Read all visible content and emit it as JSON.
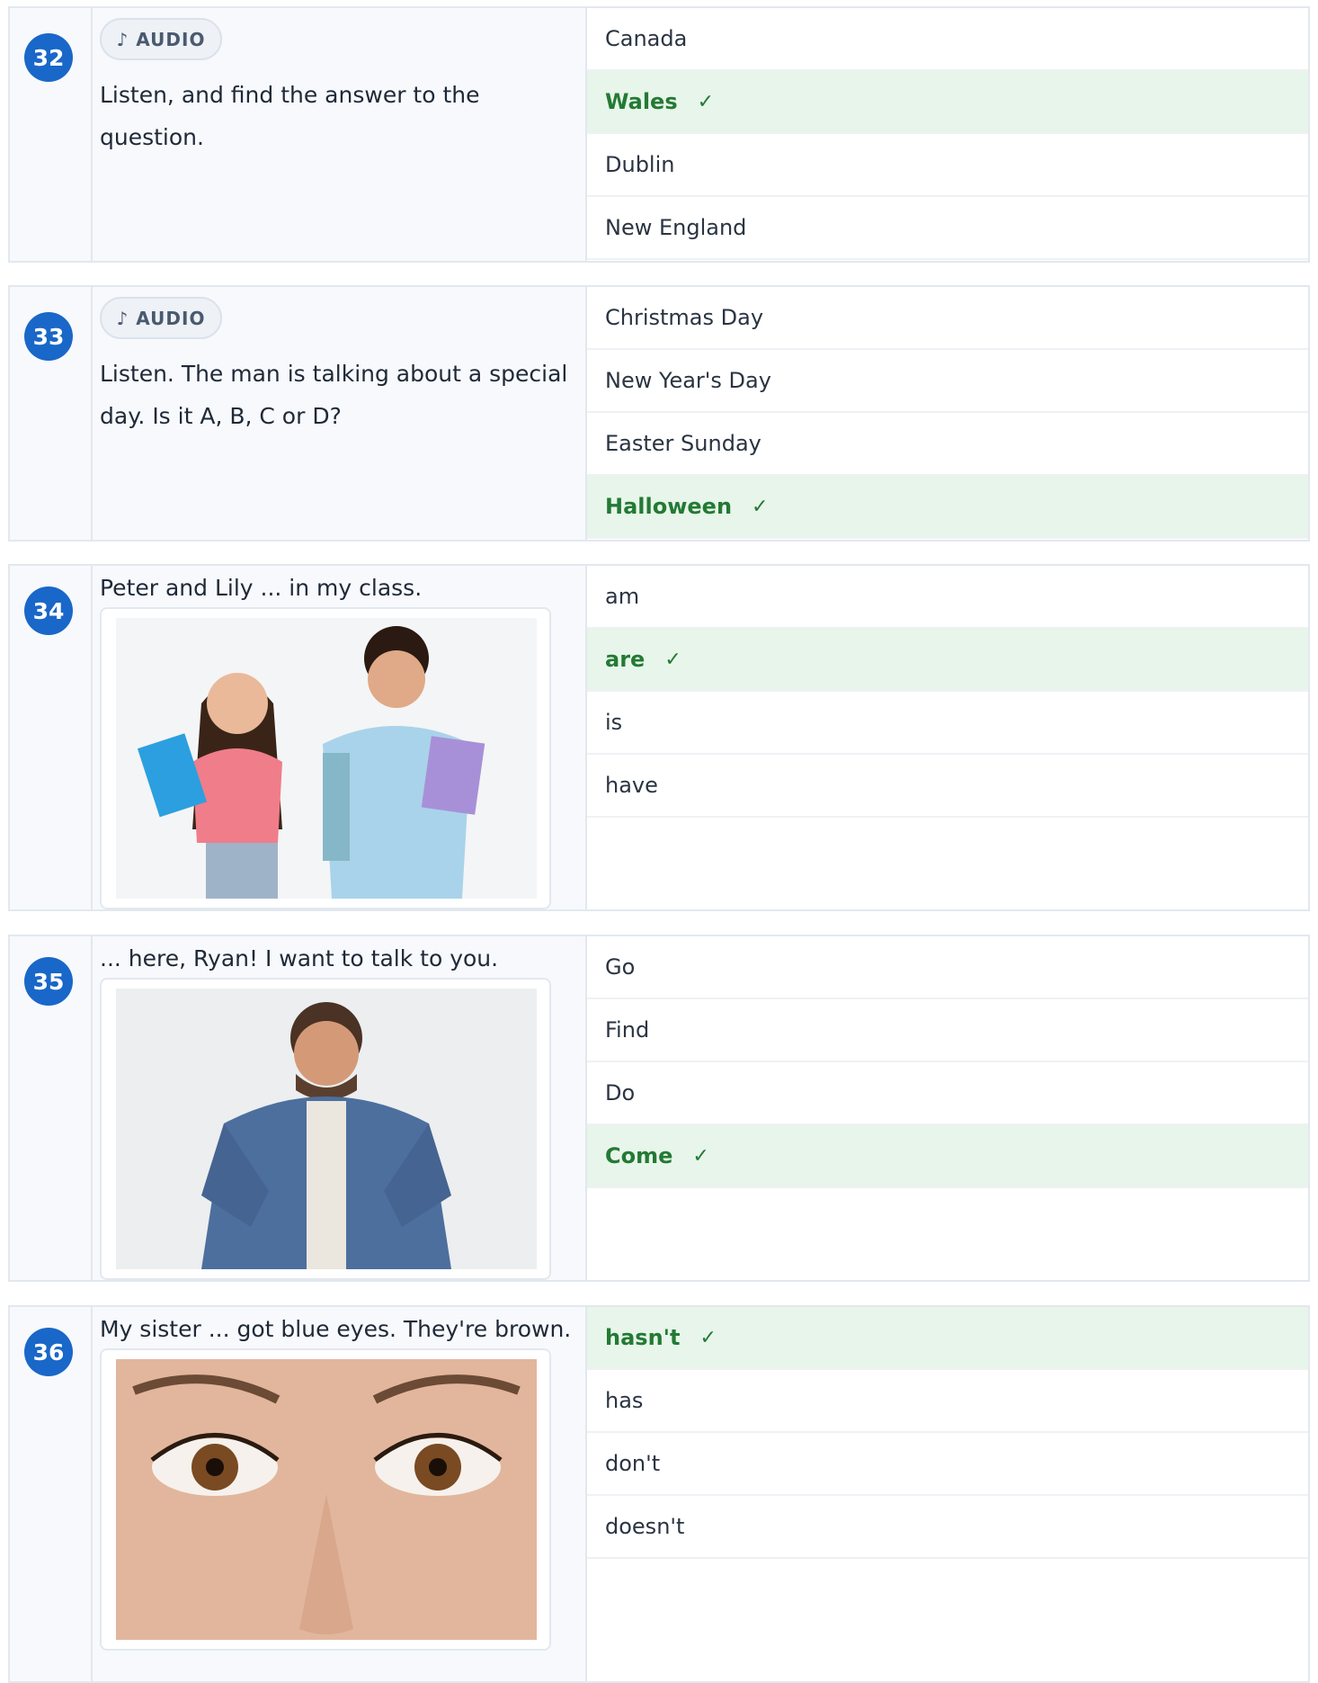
{
  "audio_label": "AUDIO",
  "audio_icon": "music-note-icon",
  "check_icon": "checkmark-icon",
  "check_glyph": "✓",
  "note_glyph": "♪",
  "colors": {
    "accent": "#1967c8",
    "correct_bg": "#e8f5ea",
    "correct_text": "#237a34"
  },
  "questions": [
    {
      "number": "32",
      "prompt": "Listen, and find the answer to the question.",
      "answers": [
        "Canada",
        "Wales",
        "Dublin",
        "New England"
      ],
      "correct_index": 1
    },
    {
      "number": "33",
      "prompt": "Listen. The man is talking about a special day. Is it A, B, C or D?",
      "answers": [
        "Christmas Day",
        "New Year's Day",
        "Easter Sunday",
        "Halloween"
      ],
      "correct_index": 3
    },
    {
      "number": "34",
      "prompt": "Peter and Lily ... in my class.",
      "answers": [
        "am",
        "are",
        "is",
        "have"
      ],
      "correct_index": 1
    },
    {
      "number": "35",
      "prompt": "... here, Ryan! I want to talk to you.",
      "answers": [
        "Go",
        "Find",
        "Do",
        "Come"
      ],
      "correct_index": 3
    },
    {
      "number": "36",
      "prompt": "My sister ... got blue eyes. They're brown.",
      "answers": [
        "hasn't",
        "has",
        "don't",
        "doesn't"
      ],
      "correct_index": 0
    }
  ]
}
